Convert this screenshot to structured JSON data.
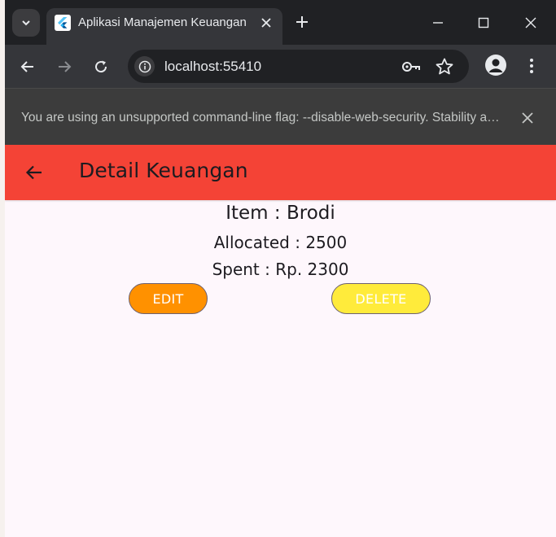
{
  "browser": {
    "tab_title": "Aplikasi Manajemen Keuangan",
    "url": "localhost:55410",
    "infobar_text": "You are using an unsupported command-line flag: --disable-web-security. Stability and security will suffer."
  },
  "app": {
    "title": "Detail Keuangan",
    "item_line": "Item : Brodi",
    "allocated_line": "Allocated : 2500",
    "spent_line": "Spent : Rp. 2300",
    "edit_label": "EDIT",
    "delete_label": "DELETE"
  },
  "colors": {
    "appbar": "#f44336",
    "page_bg": "#fef7fc",
    "edit_button": "#ff9100",
    "delete_button": "#ffeb3b"
  },
  "icons": [
    "tab-search-icon",
    "flutter-favicon-icon",
    "close-icon",
    "plus-icon",
    "minimize-icon",
    "maximize-icon",
    "back-arrow-icon",
    "forward-arrow-icon",
    "reload-icon",
    "info-icon",
    "key-icon",
    "star-icon",
    "profile-icon",
    "more-vert-icon"
  ]
}
